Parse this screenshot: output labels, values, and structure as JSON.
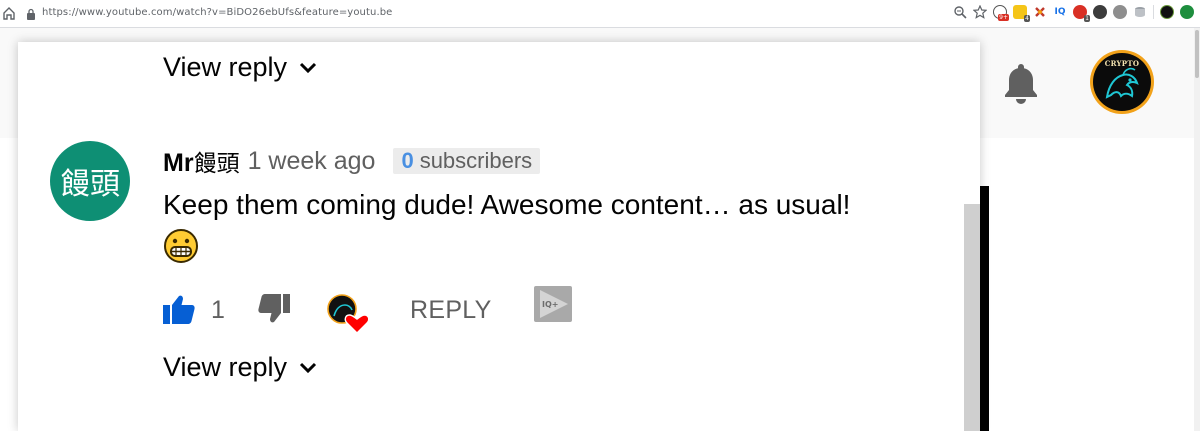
{
  "browser": {
    "url": "https://www.youtube.com/watch?v=BiDO26ebUfs&feature=youtu.be",
    "extensions": [
      {
        "icon": "zoom-icon"
      },
      {
        "icon": "star-icon"
      },
      {
        "icon": "ext-red-badge-icon",
        "badge": "9+"
      },
      {
        "icon": "ext-yellow-icon",
        "badge": "4"
      },
      {
        "icon": "ext-x-icon"
      },
      {
        "icon": "ext-iq-icon",
        "text": "IQ"
      },
      {
        "icon": "ext-red-circle-icon",
        "badge": "1"
      },
      {
        "icon": "ext-dark-icon"
      },
      {
        "icon": "ext-grey-icon"
      },
      {
        "icon": "ext-stack-icon"
      },
      {
        "icon": "profile-icon"
      },
      {
        "icon": "ext-green-icon"
      }
    ]
  },
  "header": {
    "bell_icon": "bell-icon",
    "channel_avatar_label": "CRYPTO"
  },
  "thread": {
    "view_reply_top": "View reply",
    "comment": {
      "avatar_text": "饅頭",
      "author_prefix": "Mr",
      "author_name": "饅頭",
      "time": "1 week ago",
      "subscribers_count": "0",
      "subscribers_label": "subscribers",
      "text": "Keep them coming dude! Awesome content… as usual!",
      "emoji": "grinning-face",
      "likes": "1",
      "reply_label": "REPLY",
      "iq_label": "IQ+"
    },
    "view_reply_bottom": "View reply"
  },
  "colors": {
    "avatar_bg": "#0e8f74",
    "like_blue": "#065fd4",
    "heart_red": "#ff0000",
    "subs_blue": "#4a90e2",
    "channel_ring": "#f2a21a"
  }
}
